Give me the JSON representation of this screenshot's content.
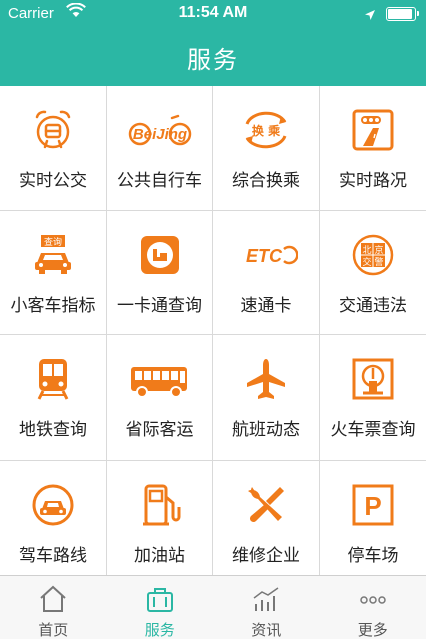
{
  "status_bar": {
    "carrier": "Carrier",
    "time": "11:54 AM"
  },
  "header": {
    "title": "服务"
  },
  "colors": {
    "brand": "#2bb7a4",
    "icon_orange": "#f07b1a",
    "text": "#222222",
    "tab_inactive": "#555555"
  },
  "grid": {
    "items": [
      {
        "label": "实时公交",
        "icon": "bus-alarm-icon"
      },
      {
        "label": "公共自行车",
        "icon": "beijing-bike-icon"
      },
      {
        "label": "综合换乘",
        "icon": "transfer-icon"
      },
      {
        "label": "实时路况",
        "icon": "traffic-light-road-icon"
      },
      {
        "label": "小客车指标",
        "icon": "car-query-icon"
      },
      {
        "label": "一卡通查询",
        "icon": "transit-card-icon"
      },
      {
        "label": "速通卡",
        "icon": "etc-icon"
      },
      {
        "label": "交通违法",
        "icon": "traffic-police-seal-icon"
      },
      {
        "label": "地铁查询",
        "icon": "subway-icon"
      },
      {
        "label": "省际客运",
        "icon": "coach-bus-icon"
      },
      {
        "label": "航班动态",
        "icon": "airplane-icon"
      },
      {
        "label": "火车票查询",
        "icon": "railway-icon"
      },
      {
        "label": "驾车路线",
        "icon": "car-route-icon"
      },
      {
        "label": "加油站",
        "icon": "gas-pump-icon"
      },
      {
        "label": "维修企业",
        "icon": "wrench-screwdriver-icon"
      },
      {
        "label": "停车场",
        "icon": "parking-icon"
      }
    ],
    "icon_texts": {
      "bike": "BeiJing",
      "transfer": "换 乘",
      "car_query": "查询",
      "etc": "ETC",
      "seal": [
        "北",
        "京",
        "交",
        "警"
      ],
      "parking": "P"
    }
  },
  "tabbar": {
    "tabs": [
      {
        "label": "首页",
        "icon": "home-icon",
        "active": false
      },
      {
        "label": "服务",
        "icon": "briefcase-icon",
        "active": true
      },
      {
        "label": "资讯",
        "icon": "chart-icon",
        "active": false
      },
      {
        "label": "更多",
        "icon": "more-dots-icon",
        "active": false
      }
    ]
  }
}
